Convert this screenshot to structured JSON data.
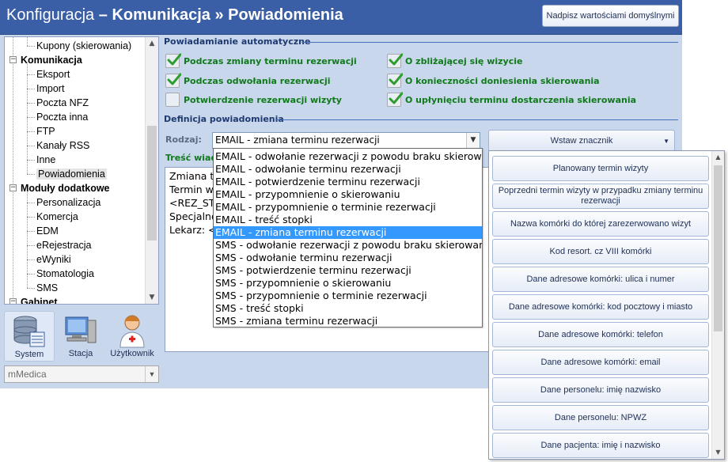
{
  "window": {
    "title_prefix": "Konfiguracja",
    "title_sep": " – ",
    "title_section": "Komunikacja",
    "title_arrow": " » ",
    "title_page": "Powiadomienia",
    "defaults_button": "Nadpisz wartościami domyślnymi"
  },
  "tree": {
    "items": [
      {
        "label": "Kupony (skierowania)",
        "level": 2
      },
      {
        "label": "Komunikacja",
        "level": 1
      },
      {
        "label": "Eksport",
        "level": 2
      },
      {
        "label": "Import",
        "level": 2
      },
      {
        "label": "Poczta NFZ",
        "level": 2
      },
      {
        "label": "Poczta inna",
        "level": 2
      },
      {
        "label": "FTP",
        "level": 2
      },
      {
        "label": "Kanały RSS",
        "level": 2
      },
      {
        "label": "Inne",
        "level": 2
      },
      {
        "label": "Powiadomienia",
        "level": 2,
        "selected": true
      },
      {
        "label": "Moduły dodatkowe",
        "level": 1
      },
      {
        "label": "Personalizacja",
        "level": 2
      },
      {
        "label": "Komercja",
        "level": 2
      },
      {
        "label": "EDM",
        "level": 2
      },
      {
        "label": "eRejestracja",
        "level": 2
      },
      {
        "label": "eWyniki",
        "level": 2
      },
      {
        "label": "Stomatologia",
        "level": 2
      },
      {
        "label": "SMS",
        "level": 2
      },
      {
        "label": "Gabinet",
        "level": 1
      }
    ]
  },
  "launchers": {
    "system": "System",
    "stacja": "Stacja",
    "uzytkownik": "Użytkownik"
  },
  "company_combo": "mMedica",
  "auto": {
    "section_title": "Powiadamianie automatyczne",
    "checks": [
      {
        "label": "Podczas zmiany terminu rezerwacji",
        "checked": true
      },
      {
        "label": "Podczas odwołania rezerwacji",
        "checked": true
      },
      {
        "label": "Potwierdzenie rezerwacji wizyty",
        "checked": false
      },
      {
        "label": "O zbliżającej się wizycie",
        "checked": true
      },
      {
        "label": "O konieczności doniesienia skierowania",
        "checked": true
      },
      {
        "label": "O upłynięciu terminu dostarczenia skierowania",
        "checked": true
      }
    ]
  },
  "definition": {
    "section_title": "Definicja powiadomienia",
    "rodzaj_label": "Rodzaj:",
    "rodzaj_value": "EMAIL - zmiana terminu rezerwacji",
    "tresc_label": "Treść wiad",
    "insert_button": "Wstaw znacznik",
    "body_lines": [
      "Zmiana te",
      "Termin w",
      "<REZ_ST",
      "Specjalno",
      "Lekarz: <"
    ]
  },
  "rodzaj_options": [
    "EMAIL - odwołanie rezerwacji z powodu braku skierowania",
    "EMAIL - odwołanie terminu rezerwacji",
    "EMAIL - potwierdzenie terminu rezerwacji",
    "EMAIL - przypomnienie o skierowaniu",
    "EMAIL - przypomnienie o terminie rezerwacji",
    "EMAIL - treść stopki",
    "EMAIL - zmiana terminu rezerwacji",
    "SMS - odwołanie rezerwacji z powodu braku skierowania",
    "SMS - odwołanie terminu rezerwacji",
    "SMS - potwierdzenie terminu rezerwacji",
    "SMS - przypomnienie o skierowaniu",
    "SMS - przypomnienie o terminie rezerwacji",
    "SMS - treść stopki",
    "SMS - zmiana terminu rezerwacji"
  ],
  "rodzaj_selected_index": 6,
  "markers": [
    "Planowany termin wizyty",
    "Poprzedni termin wizyty w przypadku zmiany terminu rezerwacji",
    "Nazwa komórki do której zarezerwowano wizyt",
    "Kod resort. cz VIII komórki",
    "Dane adresowe komórki: ulica i numer",
    "Dane adresowe komórki: kod pocztowy i miasto",
    "Dane adresowe komórki: telefon",
    "Dane adresowe komórki: email",
    "Dane personelu: imię nazwisko",
    "Dane personelu: NPWZ",
    "Dane pacjenta: imię i nazwisko"
  ],
  "colors": {
    "title_bar": "#3a5fa6",
    "window_bg": "#c9d7ec",
    "check_green": "#0e7a19",
    "selection": "#3399ff"
  }
}
